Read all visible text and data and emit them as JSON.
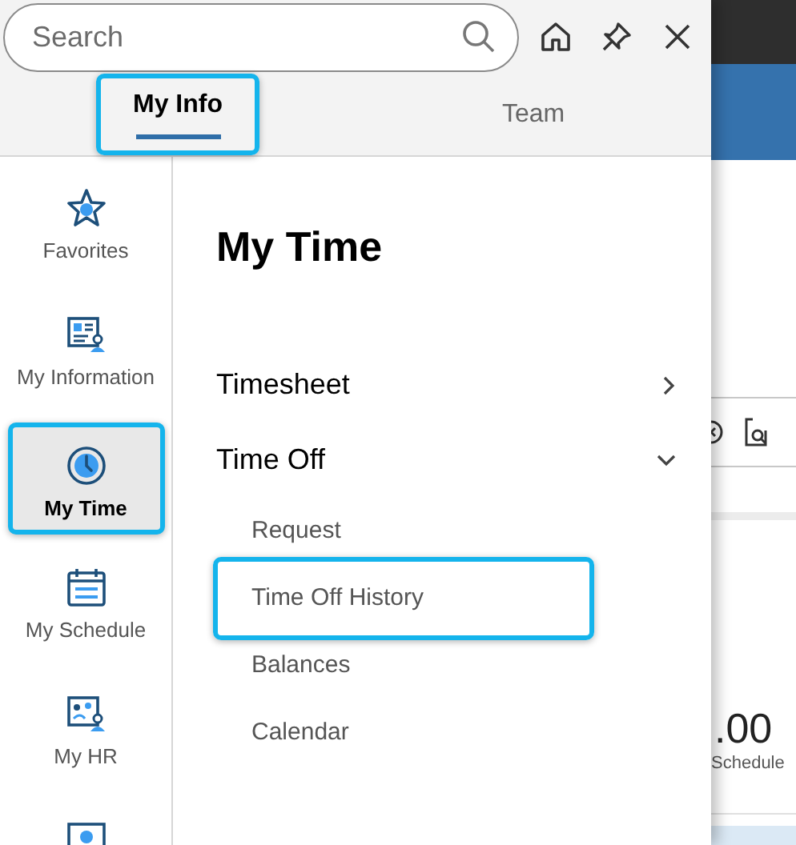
{
  "search": {
    "placeholder": "Search"
  },
  "tabs": [
    {
      "label": "My Info",
      "selected": true,
      "highlighted": true
    },
    {
      "label": "Team",
      "selected": false,
      "highlighted": false
    }
  ],
  "sidebar": {
    "items": [
      {
        "kind": "star",
        "label": "Favorites",
        "selected": false,
        "highlighted": false
      },
      {
        "kind": "id-card",
        "label": "My Information",
        "selected": false,
        "highlighted": false
      },
      {
        "kind": "clock",
        "label": "My Time",
        "selected": true,
        "highlighted": true
      },
      {
        "kind": "calendar",
        "label": "My Schedule",
        "selected": false,
        "highlighted": false
      },
      {
        "kind": "people",
        "label": "My HR",
        "selected": false,
        "highlighted": false
      },
      {
        "kind": "profile",
        "selected": false,
        "highlighted": false
      }
    ]
  },
  "main": {
    "title": "My Time",
    "items": [
      {
        "label": "Timesheet",
        "expanded": false
      },
      {
        "label": "Time Off",
        "expanded": true,
        "children": [
          {
            "label": "Request",
            "highlighted": false
          },
          {
            "label": "Time Off History",
            "highlighted": true
          },
          {
            "label": "Balances",
            "highlighted": false
          },
          {
            "label": "Calendar",
            "highlighted": false
          }
        ]
      }
    ]
  },
  "background_page": {
    "value": ".00",
    "caption": "Schedule"
  }
}
